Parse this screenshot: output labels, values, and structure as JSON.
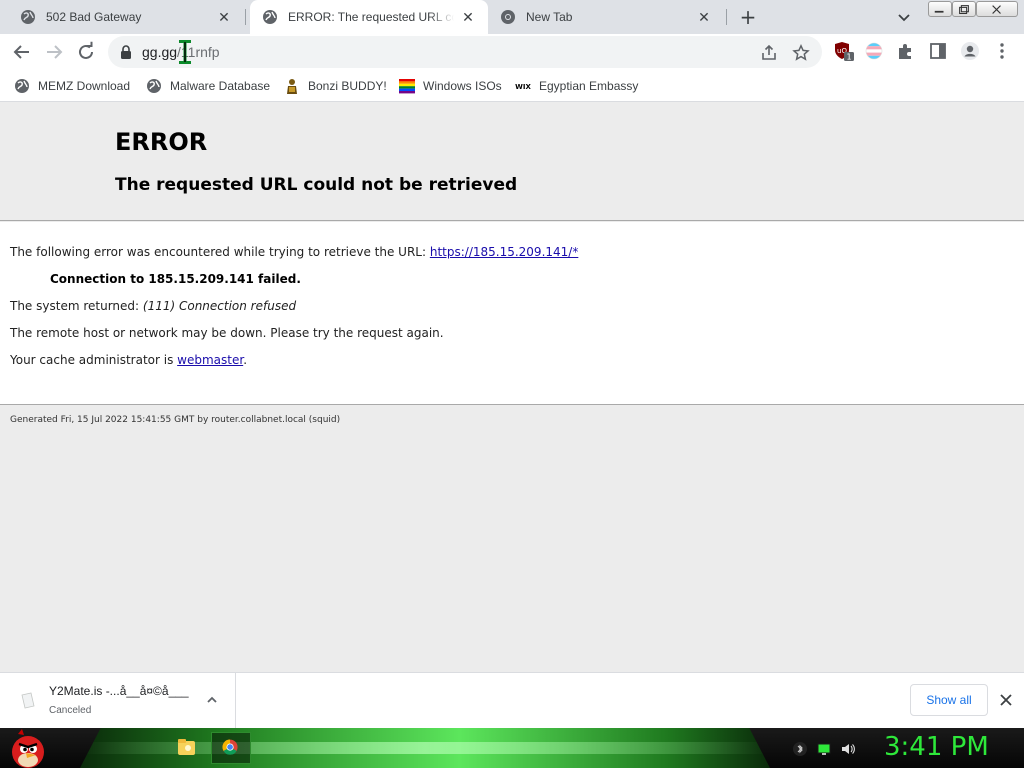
{
  "tabs": [
    {
      "title": "502 Bad Gateway",
      "active": false
    },
    {
      "title": "ERROR: The requested URL could",
      "active": true
    },
    {
      "title": "New Tab",
      "active": false
    }
  ],
  "omnibox": {
    "url_host": "gg.gg",
    "url_path": "/11rnfp"
  },
  "bookmarks": [
    {
      "label": "MEMZ Download",
      "icon": "globe-icon"
    },
    {
      "label": "Malware Database",
      "icon": "globe-icon"
    },
    {
      "label": "Bonzi BUDDY!",
      "icon": "bonzi-icon"
    },
    {
      "label": "Windows ISOs",
      "icon": "rainbow-flag-icon"
    },
    {
      "label": "Egyptian Embassy",
      "icon": "wix-icon"
    }
  ],
  "extensions": {
    "ublock_badge": "1"
  },
  "error_page": {
    "heading": "ERROR",
    "subheading": "The requested URL could not be retrieved",
    "line1_prefix": "The following error was encountered while trying to retrieve the URL: ",
    "line1_link": "https://185.15.209.141/*",
    "line2": "Connection to 185.15.209.141 failed.",
    "line3_prefix": "The system returned: ",
    "line3_italic": "(111) Connection refused",
    "line4": "The remote host or network may be down. Please try the request again.",
    "line5_prefix": "Your cache administrator is ",
    "line5_link": "webmaster",
    "line5_suffix": ".",
    "generated": "Generated Fri, 15 Jul 2022 15:41:55 GMT by router.collabnet.local (squid)"
  },
  "download_shelf": {
    "file_name": "Y2Mate.is -...å__å¤©å___",
    "status": "Canceled",
    "show_all": "Show all"
  },
  "taskbar": {
    "clock": "3:41 PM",
    "clock_color": "#2ee83a"
  }
}
